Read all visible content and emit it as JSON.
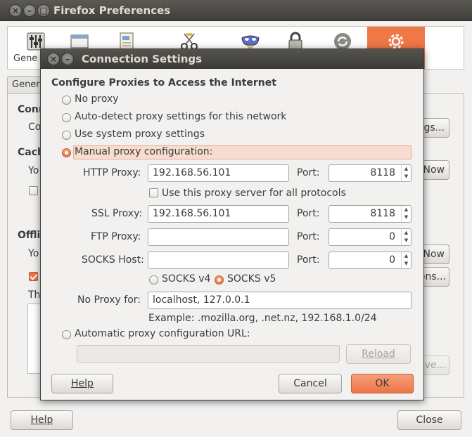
{
  "prefs": {
    "title": "Firefox Preferences",
    "toolbar_items": [
      "General",
      "Tabs",
      "Content",
      "Applications",
      "Privacy",
      "Security",
      "Sync",
      "Advanced"
    ],
    "first_toolbar_label_visible": "Gene",
    "tab_visible": "Genera",
    "fragments": {
      "conn": "Conn",
      "co": "Co",
      "cach": "Cach",
      "yo1": "Yo",
      "offl": "Offli",
      "yo2": "Yo",
      "th": "Th",
      "settings_btn": "gs...",
      "now1": "Now",
      "now2": "Now",
      "ons_btn": "ons...",
      "ve_btn": "ve..."
    },
    "help_label": "Help",
    "close_label": "Close"
  },
  "dialog": {
    "title": "Connection Settings",
    "heading": "Configure Proxies to Access the Internet",
    "options": {
      "no_proxy": "No proxy",
      "auto_detect": "Auto-detect proxy settings for this network",
      "system": "Use system proxy settings",
      "manual": "Manual proxy configuration:",
      "auto_url": "Automatic proxy configuration URL:"
    },
    "selected_option": "manual",
    "http": {
      "label": "HTTP Proxy:",
      "value": "192.168.56.101",
      "port_label": "Port:",
      "port": "8118"
    },
    "use_all": {
      "label": "Use this proxy server for all protocols",
      "checked": false
    },
    "ssl": {
      "label": "SSL Proxy:",
      "value": "192.168.56.101",
      "port_label": "Port:",
      "port": "8118"
    },
    "ftp": {
      "label": "FTP Proxy:",
      "value": "",
      "port_label": "Port:",
      "port": "0"
    },
    "socks": {
      "label": "SOCKS Host:",
      "value": "",
      "port_label": "Port:",
      "port": "0"
    },
    "socks_version": {
      "v4": "SOCKS v4",
      "v5": "SOCKS v5",
      "selected": "v5"
    },
    "no_proxy_for": {
      "label": "No Proxy for:",
      "value": "localhost, 127.0.0.1",
      "example": "Example: .mozilla.org, .net.nz, 192.168.1.0/24"
    },
    "auto_url_value": "",
    "reload_label": "Reload",
    "help_label": "Help",
    "cancel_label": "Cancel",
    "ok_label": "OK"
  },
  "colors": {
    "accent": "#ee7446",
    "titlebar": "#3c3b37",
    "highlight": "#f8dcd0"
  }
}
